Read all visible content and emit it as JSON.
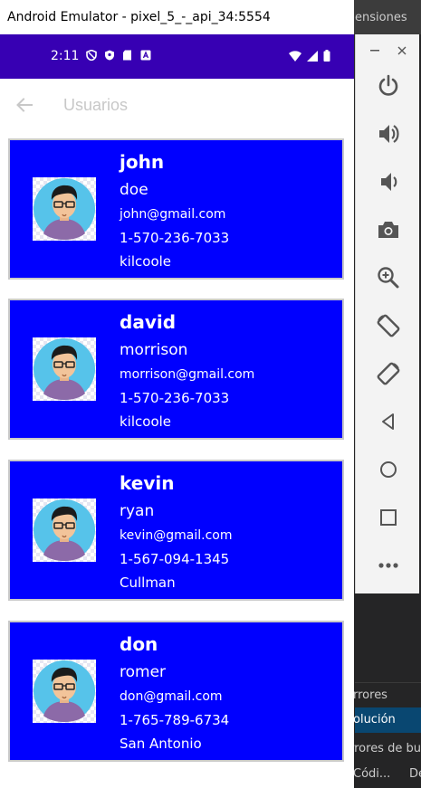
{
  "window": {
    "title": "Android Emulator - pixel_5_-_api_34:5554"
  },
  "background_ide": {
    "top_text": "ensiones",
    "rows": [
      {
        "text": "rrores"
      },
      {
        "text": "olución"
      },
      {
        "text": "rrores de bu"
      },
      {
        "text": "Códi...",
        "text2": "De"
      }
    ]
  },
  "status_bar": {
    "time": "2:11",
    "color": "#3700b3"
  },
  "app_bar": {
    "title": "Usuarios"
  },
  "users": [
    {
      "first": "john",
      "last": "doe",
      "email": "john@gmail.com",
      "phone": "1-570-236-7033",
      "city": "kilcoole"
    },
    {
      "first": "david",
      "last": "morrison",
      "email": "morrison@gmail.com",
      "phone": "1-570-236-7033",
      "city": "kilcoole"
    },
    {
      "first": "kevin",
      "last": "ryan",
      "email": "kevin@gmail.com",
      "phone": "1-567-094-1345",
      "city": "Cullman"
    },
    {
      "first": "don",
      "last": "romer",
      "email": "don@gmail.com",
      "phone": "1-765-789-6734",
      "city": "San Antonio"
    }
  ],
  "card_color": "#0000ff",
  "side_toolbar": {
    "icons": [
      "power-icon",
      "volume-up-icon",
      "volume-down-icon",
      "camera-icon",
      "zoom-icon",
      "rotate-left-icon",
      "rotate-right-icon",
      "back-icon",
      "home-icon",
      "overview-icon",
      "more-icon"
    ]
  }
}
